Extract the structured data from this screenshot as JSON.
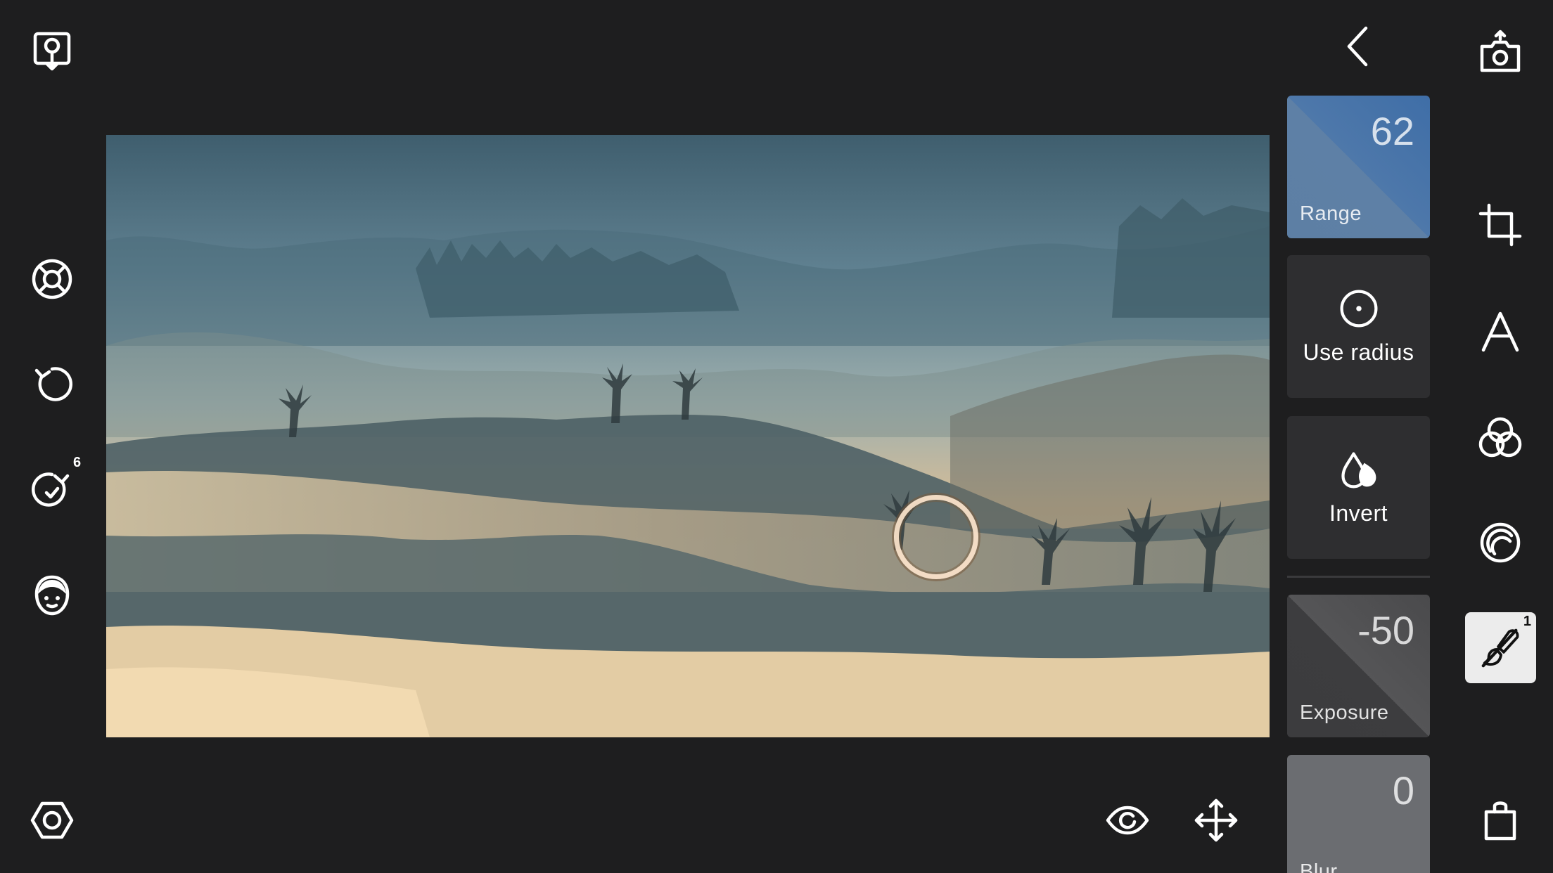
{
  "left_toolbar": {
    "redo_count": "6"
  },
  "tiles": {
    "range": {
      "value": "62",
      "label": "Range"
    },
    "use_radius": {
      "label": "Use radius"
    },
    "invert": {
      "label": "Invert"
    },
    "exposure": {
      "value": "-50",
      "label": "Exposure"
    },
    "blur": {
      "value": "0",
      "label": "Blur"
    }
  },
  "right_toolbar": {
    "active_tool_badge": "1"
  },
  "colors": {
    "background": "#1e1e1f",
    "tile_range": "#4e78aa",
    "tile_action": "#2e2e30",
    "tile_exposure": "#4a4a4c",
    "tile_blur": "#6b6d71",
    "active_tool_bg": "#ececec",
    "focus_ring": "#f8e0c8"
  }
}
